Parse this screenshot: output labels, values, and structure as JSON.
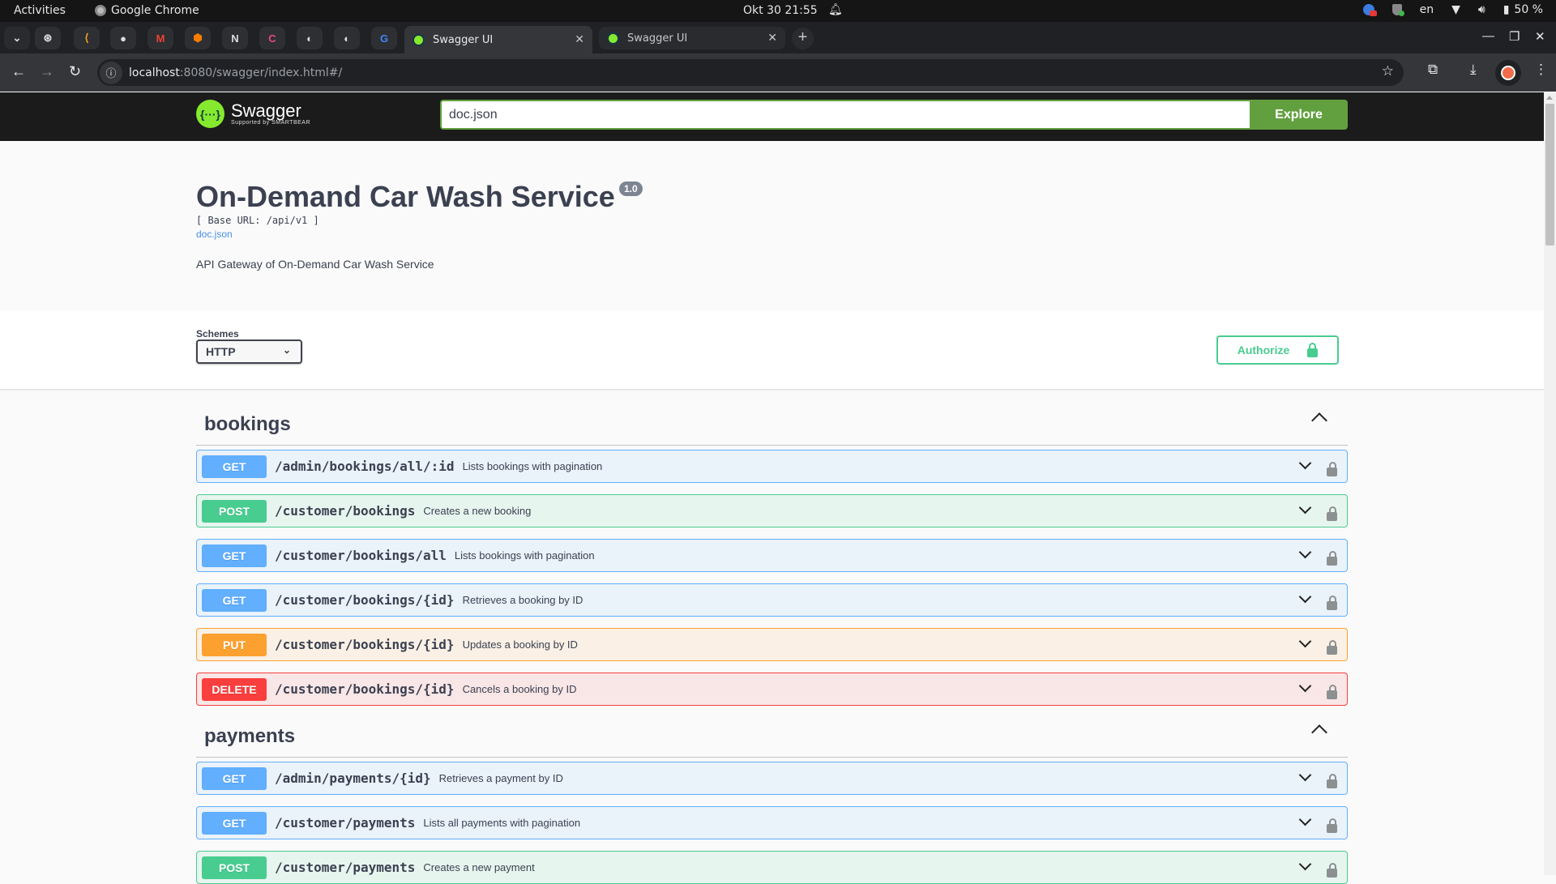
{
  "os_bar": {
    "activities": "Activities",
    "app_name": "Google Chrome",
    "datetime": "Okt 30  21:55",
    "language": "en",
    "battery": "50 %"
  },
  "browser": {
    "pinned_tabs": [
      "chatgpt-icon",
      "leetcode-icon",
      "github-icon",
      "gmail-icon",
      "box-icon",
      "notion-icon",
      "clickup-icon",
      "globe-icon",
      "globe-icon",
      "translate-icon"
    ],
    "tabs": [
      {
        "title": "Swagger UI",
        "active": true
      },
      {
        "title": "Swagger UI",
        "active": false
      }
    ],
    "url_host": "localhost",
    "url_rest": ":8080/swagger/index.html#/"
  },
  "swagger_top": {
    "logo_name": "Swagger",
    "logo_sub": "Supported by SMARTBEAR",
    "spec_input": "doc.json",
    "explore_label": "Explore"
  },
  "info": {
    "title": "On-Demand Car Wash Service",
    "version": "1.0",
    "base_url": "[ Base URL: /api/v1 ]",
    "spec_link": "doc.json",
    "description": "API Gateway of On-Demand Car Wash Service"
  },
  "schemes": {
    "label": "Schemes",
    "selected": "HTTP",
    "authorize_label": "Authorize"
  },
  "tags": [
    {
      "name": "bookings",
      "operations": [
        {
          "method": "GET",
          "path": "/admin/bookings/all/:id",
          "summary": "Lists bookings with pagination"
        },
        {
          "method": "POST",
          "path": "/customer/bookings",
          "summary": "Creates a new booking"
        },
        {
          "method": "GET",
          "path": "/customer/bookings/all",
          "summary": "Lists bookings with pagination"
        },
        {
          "method": "GET",
          "path": "/customer/bookings/{id}",
          "summary": "Retrieves a booking by ID"
        },
        {
          "method": "PUT",
          "path": "/customer/bookings/{id}",
          "summary": "Updates a booking by ID"
        },
        {
          "method": "DELETE",
          "path": "/customer/bookings/{id}",
          "summary": "Cancels a booking by ID"
        }
      ]
    },
    {
      "name": "payments",
      "operations": [
        {
          "method": "GET",
          "path": "/admin/payments/{id}",
          "summary": "Retrieves a payment by ID"
        },
        {
          "method": "GET",
          "path": "/customer/payments",
          "summary": "Lists all payments with pagination"
        },
        {
          "method": "POST",
          "path": "/customer/payments",
          "summary": "Creates a new payment"
        }
      ]
    }
  ],
  "colors": {
    "get": "#61affe",
    "post": "#49cc90",
    "put": "#fca130",
    "delete": "#f93e3e",
    "swagger_green": "#62a03f"
  }
}
